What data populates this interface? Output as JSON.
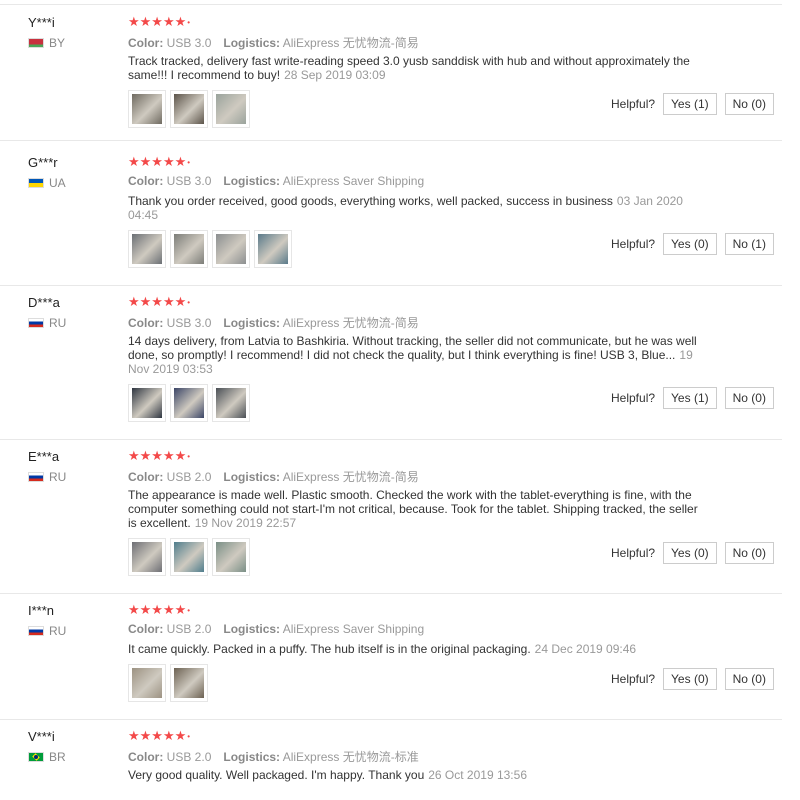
{
  "ui": {
    "color_label": "Color:",
    "logistics_label": "Logistics:",
    "helpful_label": "Helpful?"
  },
  "reviews": [
    {
      "user": "Y***i",
      "country": "BY",
      "stars": "★★★★★",
      "color": "USB 3.0",
      "logistics": "AliExpress 无忧物流-简易",
      "text": "Track tracked, delivery fast write-reading speed 3.0 yusb sanddisk with hub and without approximately the same!!! I recommend to buy!",
      "date": "28 Sep 2019 03:09",
      "yes": "Yes (1)",
      "no": "No (0)",
      "photos": [
        "#6f6a60",
        "#5c544a",
        "#9aa39c"
      ]
    },
    {
      "user": "G***r",
      "country": "UA",
      "stars": "★★★★★",
      "color": "USB 3.0",
      "logistics": "AliExpress Saver Shipping",
      "text": "Thank you order received, good goods, everything works, well packed, success in business",
      "date": "03 Jan 2020 04:45",
      "yes": "Yes (0)",
      "no": "No (1)",
      "photos": [
        "#6b6f74",
        "#7c7d78",
        "#8c8f90",
        "#5a7a8a"
      ]
    },
    {
      "user": "D***a",
      "country": "RU",
      "stars": "★★★★★",
      "color": "USB 3.0",
      "logistics": "AliExpress 无忧物流-简易",
      "text": "14 days delivery, from Latvia to Bashkiria. Without tracking, the seller did not communicate, but he was well done, so promptly! I recommend! I did not check the quality, but I think everything is fine! USB 3, Blue...",
      "date": "19 Nov 2019 03:53",
      "yes": "Yes (1)",
      "no": "No (0)",
      "photos": [
        "#2e3540",
        "#3b4566",
        "#4a4f55"
      ]
    },
    {
      "user": "E***a",
      "country": "RU",
      "stars": "★★★★★",
      "color": "USB 2.0",
      "logistics": "AliExpress 无忧物流-简易",
      "text": "The appearance is made well. Plastic smooth. Checked the work with the tablet-everything is fine, with the computer something could not start-I'm not critical, because. Took for the tablet. Shipping tracked, the seller is excellent.",
      "date": "19 Nov 2019 22:57",
      "yes": "Yes (0)",
      "no": "No (0)",
      "photos": [
        "#6d6e74",
        "#4f7d8c",
        "#7a8f86"
      ]
    },
    {
      "user": "I***n",
      "country": "RU",
      "stars": "★★★★★",
      "color": "USB 2.0",
      "logistics": "AliExpress Saver Shipping",
      "text": "It came quickly. Packed in a puffy. The hub itself is in the original packaging.",
      "date": "24 Dec 2019 09:46",
      "yes": "Yes (0)",
      "no": "No (0)",
      "photos": [
        "#9c9282",
        "#6c6152"
      ]
    },
    {
      "user": "V***i",
      "country": "BR",
      "stars": "★★★★★",
      "color": "USB 2.0",
      "logistics": "AliExpress 无忧物流-标准",
      "text": "Very good quality. Well packaged. I'm happy. Thank you",
      "date": "26 Oct 2019 13:56"
    }
  ]
}
